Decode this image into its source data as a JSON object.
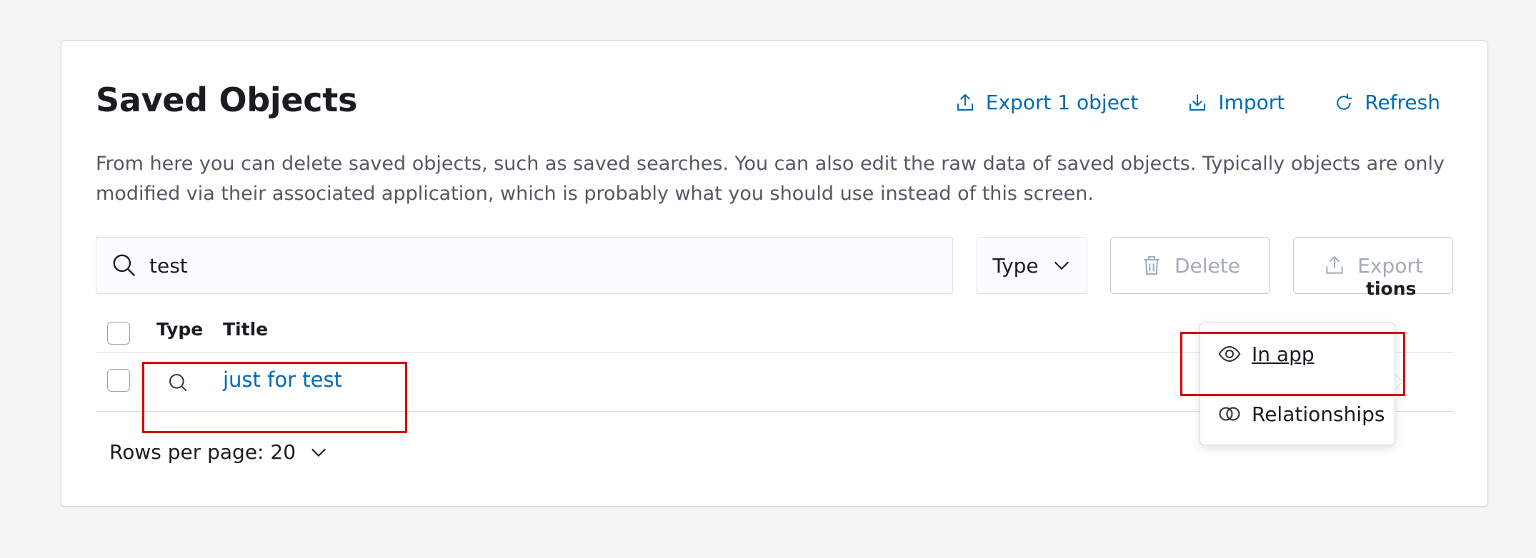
{
  "header": {
    "title": "Saved Objects",
    "actions": {
      "export_label": "Export 1 object",
      "import_label": "Import",
      "refresh_label": "Refresh"
    }
  },
  "description": "From here you can delete saved objects, such as saved searches. You can also edit the raw data of saved objects. Typically objects are only modified via their associated application, which is probably what you should use instead of this screen.",
  "toolbar": {
    "search_value": "test",
    "type_filter_label": "Type",
    "delete_label": "Delete",
    "export_label": "Export"
  },
  "table": {
    "columns": {
      "type": "Type",
      "title": "Title",
      "actions_partial": "tions"
    },
    "rows": [
      {
        "type_icon": "search-icon",
        "title": "just for test"
      }
    ]
  },
  "pagination": {
    "rows_per_page_label": "Rows per page: 20"
  },
  "actions_popover": {
    "items": [
      {
        "label": "In app",
        "icon": "eye-icon"
      },
      {
        "label": "Relationships",
        "icon": "relationships-icon"
      }
    ]
  },
  "colors": {
    "link": "#006bb8",
    "disabled_text": "#a2abba",
    "highlight": "#d40000",
    "background": "#f5f5f5"
  }
}
